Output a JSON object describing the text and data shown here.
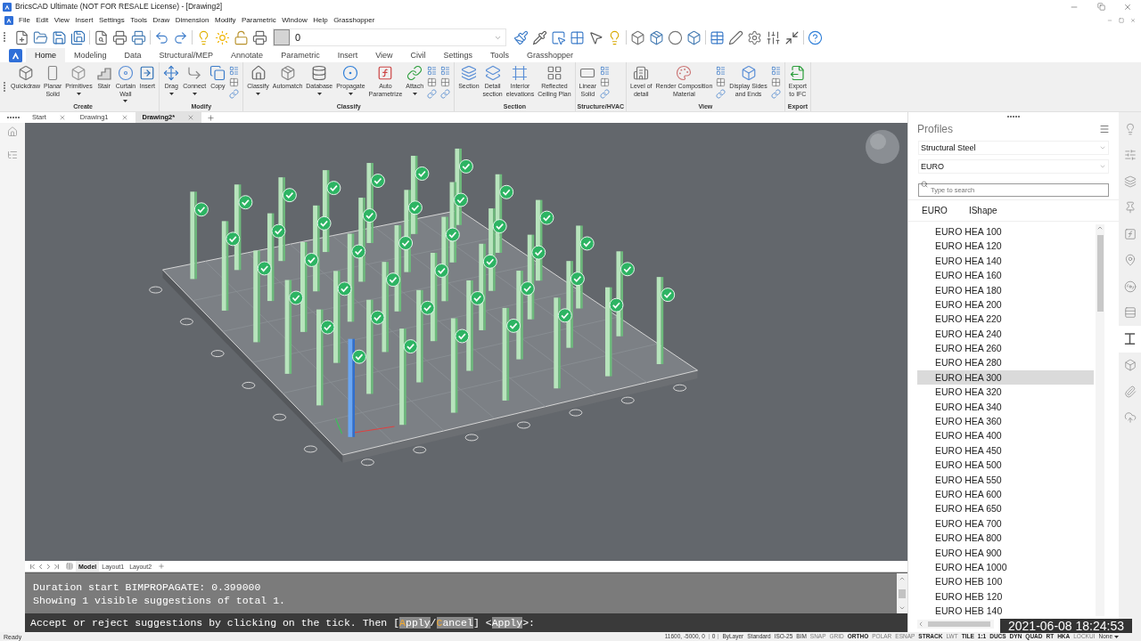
{
  "window": {
    "title": "BricsCAD Ultimate (NOT FOR RESALE License) - [Drawing2]"
  },
  "menu_bar": [
    "File",
    "Edit",
    "View",
    "Insert",
    "Settings",
    "Tools",
    "Draw",
    "Dimension",
    "Modify",
    "Parametric",
    "Window",
    "Help",
    "Grasshopper"
  ],
  "quick_access": {
    "layer": "0"
  },
  "ribbon": {
    "tabs": [
      {
        "label": "Home",
        "selected": true
      },
      {
        "label": "Modeling",
        "selected": false
      },
      {
        "label": "Data",
        "selected": false
      },
      {
        "label": "Structural/MEP",
        "selected": false
      },
      {
        "label": "Annotate",
        "selected": false
      },
      {
        "label": "Parametric",
        "selected": false
      },
      {
        "label": "Insert",
        "selected": false
      },
      {
        "label": "View",
        "selected": false
      },
      {
        "label": "Civil",
        "selected": false
      },
      {
        "label": "Settings",
        "selected": false
      },
      {
        "label": "Tools",
        "selected": false
      },
      {
        "label": "Grasshopper",
        "selected": false
      }
    ],
    "groups": [
      {
        "label": "Create",
        "items": [
          {
            "kind": "button",
            "lines": [
              "Quickdraw"
            ],
            "menu": false
          },
          {
            "kind": "button",
            "lines": [
              "Planar",
              "Solid"
            ],
            "menu": false
          },
          {
            "kind": "button",
            "lines": [
              "Primitives"
            ],
            "menu": true
          },
          {
            "kind": "button",
            "lines": [
              "Stair"
            ],
            "menu": false
          },
          {
            "kind": "button",
            "lines": [
              "Curtain",
              "Wall"
            ],
            "menu": true
          },
          {
            "kind": "button",
            "lines": [
              "Insert"
            ],
            "menu": false
          }
        ]
      },
      {
        "label": "Modify",
        "items": [
          {
            "kind": "button",
            "lines": [
              "Drag"
            ],
            "menu": true
          },
          {
            "kind": "button",
            "lines": [
              "Connect"
            ],
            "menu": true
          },
          {
            "kind": "button",
            "lines": [
              "Copy"
            ],
            "menu": false
          },
          {
            "kind": "icon_stack"
          }
        ]
      },
      {
        "label": "Classify",
        "items": [
          {
            "kind": "button",
            "lines": [
              "Classify"
            ],
            "menu": true
          },
          {
            "kind": "button",
            "lines": [
              "Automatch"
            ],
            "menu": false
          },
          {
            "kind": "button",
            "lines": [
              "Database"
            ],
            "menu": true
          },
          {
            "kind": "button",
            "lines": [
              "Propagate"
            ],
            "menu": true
          },
          {
            "kind": "button",
            "lines": [
              "Auto",
              "Parametrize"
            ],
            "menu": false
          },
          {
            "kind": "button",
            "lines": [
              "Attach"
            ],
            "menu": true
          },
          {
            "kind": "icon_stack"
          },
          {
            "kind": "icon_stack"
          }
        ]
      },
      {
        "label": "Section",
        "items": [
          {
            "kind": "button",
            "lines": [
              "Section"
            ],
            "menu": false
          },
          {
            "kind": "button",
            "lines": [
              "Detail",
              "section"
            ],
            "menu": false
          },
          {
            "kind": "button",
            "lines": [
              "Interior",
              "elevations"
            ],
            "menu": false
          },
          {
            "kind": "button",
            "lines": [
              "Reflected",
              "Ceiling Plan"
            ],
            "menu": false
          }
        ]
      },
      {
        "label": "Structure/HVAC",
        "items": [
          {
            "kind": "button",
            "lines": [
              "Linear",
              "Solid"
            ],
            "menu": false
          },
          {
            "kind": "icon_stack"
          }
        ]
      },
      {
        "label": "View",
        "items": [
          {
            "kind": "button",
            "lines": [
              "Level of",
              "detail"
            ],
            "menu": false
          },
          {
            "kind": "button",
            "lines": [
              "Render Composition",
              "Material"
            ],
            "menu": false
          },
          {
            "kind": "icon_stack"
          },
          {
            "kind": "button",
            "lines": [
              "Display Sides",
              "and Ends"
            ],
            "menu": false
          },
          {
            "kind": "icon_stack"
          }
        ]
      },
      {
        "label": "Export",
        "items": [
          {
            "kind": "button",
            "lines": [
              "Export",
              "to IFC"
            ],
            "menu": false
          }
        ]
      }
    ]
  },
  "document_tabs": [
    {
      "label": "Start",
      "selected": false
    },
    {
      "label": "Drawing1",
      "selected": false
    },
    {
      "label": "Drawing2*",
      "selected": true
    }
  ],
  "layout_tabs": [
    {
      "label": "Model",
      "selected": true
    },
    {
      "label": "Layout1",
      "selected": false
    },
    {
      "label": "Layout2",
      "selected": false
    }
  ],
  "command_line": {
    "history": [
      "Duration start BIMPROPAGATE: 0.399000",
      "Showing 1 visible suggestions of total 1."
    ],
    "prompt": [
      {
        "kind": "text",
        "text": "Accept or reject suggestions by clicking on the tick. Then ["
      },
      {
        "kind": "option",
        "key": "A",
        "text": "pply"
      },
      {
        "kind": "text",
        "text": "/"
      },
      {
        "kind": "option",
        "key": "C",
        "text": "ancel"
      },
      {
        "kind": "text",
        "text": "] <"
      },
      {
        "kind": "default",
        "text": "Apply"
      },
      {
        "kind": "text",
        "text": ">:"
      }
    ]
  },
  "profiles_panel": {
    "title": "Profiles",
    "category": "Structural Steel",
    "standard": "EURO",
    "search": {
      "placeholder": "Type to search"
    },
    "breadcrumb": [
      "EURO",
      "IShape"
    ],
    "items": [
      {
        "name": "EURO HEA 100",
        "selected": false
      },
      {
        "name": "EURO HEA 120",
        "selected": false
      },
      {
        "name": "EURO HEA 140",
        "selected": false
      },
      {
        "name": "EURO HEA 160",
        "selected": false
      },
      {
        "name": "EURO HEA 180",
        "selected": false
      },
      {
        "name": "EURO HEA 200",
        "selected": false
      },
      {
        "name": "EURO HEA 220",
        "selected": false
      },
      {
        "name": "EURO HEA 240",
        "selected": false
      },
      {
        "name": "EURO HEA 260",
        "selected": false
      },
      {
        "name": "EURO HEA 280",
        "selected": false
      },
      {
        "name": "EURO HEA 300",
        "selected": true
      },
      {
        "name": "EURO HEA 320",
        "selected": false
      },
      {
        "name": "EURO HEA 340",
        "selected": false
      },
      {
        "name": "EURO HEA 360",
        "selected": false
      },
      {
        "name": "EURO HEA 400",
        "selected": false
      },
      {
        "name": "EURO HEA 450",
        "selected": false
      },
      {
        "name": "EURO HEA 500",
        "selected": false
      },
      {
        "name": "EURO HEA 550",
        "selected": false
      },
      {
        "name": "EURO HEA 600",
        "selected": false
      },
      {
        "name": "EURO HEA 650",
        "selected": false
      },
      {
        "name": "EURO HEA 700",
        "selected": false
      },
      {
        "name": "EURO HEA 800",
        "selected": false
      },
      {
        "name": "EURO HEA 900",
        "selected": false
      },
      {
        "name": "EURO HEA 1000",
        "selected": false
      },
      {
        "name": "EURO HEB 100",
        "selected": false
      },
      {
        "name": "EURO HEB 120",
        "selected": false
      },
      {
        "name": "EURO HEB 140",
        "selected": false
      }
    ]
  },
  "side_tabs": [
    {
      "selected": false
    },
    {
      "selected": false
    },
    {
      "selected": false
    },
    {
      "selected": false
    },
    {
      "selected": false
    },
    {
      "selected": false
    },
    {
      "selected": false
    },
    {
      "selected": false
    },
    {
      "selected": true
    },
    {
      "selected": false
    },
    {
      "selected": false
    },
    {
      "selected": false
    }
  ],
  "status_bar": {
    "message": "Ready",
    "coordinates": "11600, -5000, 0",
    "fields": [
      "0",
      "ByLayer",
      "Standard",
      "ISO-25",
      "BIM"
    ],
    "toggles": [
      {
        "label": "SNAP",
        "on": false
      },
      {
        "label": "GRID",
        "on": false
      },
      {
        "label": "ORTHO",
        "on": true
      },
      {
        "label": "POLAR",
        "on": false
      },
      {
        "label": "ESNAP",
        "on": false
      },
      {
        "label": "STRACK",
        "on": true
      },
      {
        "label": "LWT",
        "on": false
      },
      {
        "label": "TILE",
        "on": true
      },
      {
        "label": "1:1",
        "on": true
      },
      {
        "label": "DUCS",
        "on": true
      },
      {
        "label": "DYN",
        "on": true
      },
      {
        "label": "QUAD",
        "on": true
      },
      {
        "label": "RT",
        "on": true
      },
      {
        "label": "HKA",
        "on": true
      },
      {
        "label": "LOCKUI",
        "on": false
      }
    ],
    "annotation_scale": "None"
  },
  "recording_timestamp": "2021-06-08 18:24:53"
}
